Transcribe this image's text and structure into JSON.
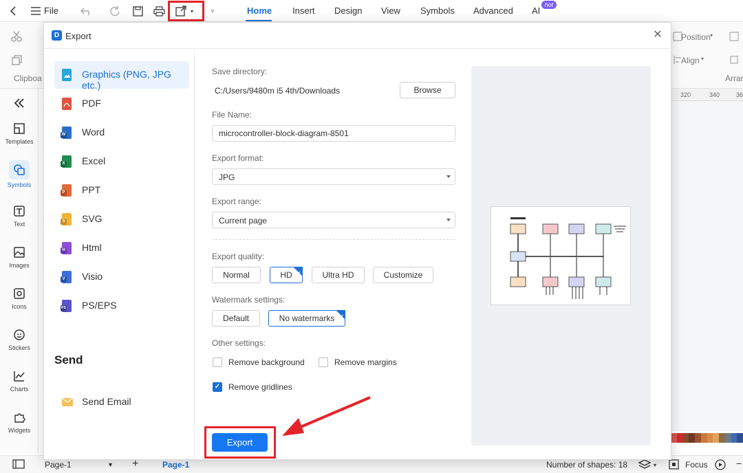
{
  "toolbar": {
    "file_label": "File",
    "tabs": [
      "Home",
      "Insert",
      "Design",
      "View",
      "Symbols",
      "Advanced",
      "AI"
    ],
    "ai_badge": "hot"
  },
  "ribbon": {
    "clipboard_label": "Clipboa",
    "position_label": "Position",
    "align_label": "Align",
    "arrange_label": "Arran",
    "ruler_ticks": [
      "320",
      "340",
      "36"
    ]
  },
  "sidebar": {
    "items": [
      {
        "label": "Templates",
        "icon": "templates-icon"
      },
      {
        "label": "Symbols",
        "icon": "symbols-icon"
      },
      {
        "label": "Text",
        "icon": "text-icon"
      },
      {
        "label": "Images",
        "icon": "images-icon"
      },
      {
        "label": "Icons",
        "icon": "icons-icon"
      },
      {
        "label": "Stickers",
        "icon": "stickers-icon"
      },
      {
        "label": "Charts",
        "icon": "charts-icon"
      },
      {
        "label": "Widgets",
        "icon": "widgets-icon"
      }
    ]
  },
  "dialog": {
    "title": "Export",
    "nav": [
      {
        "label": "Graphics (PNG, JPG etc.)",
        "color": "#2aa6d8",
        "badge": ""
      },
      {
        "label": "PDF",
        "color": "#e0533f",
        "badge": ""
      },
      {
        "label": "Word",
        "color": "#2b6cc4",
        "badge": "W"
      },
      {
        "label": "Excel",
        "color": "#1f8b4c",
        "badge": "X"
      },
      {
        "label": "PPT",
        "color": "#e2693a",
        "badge": "P"
      },
      {
        "label": "SVG",
        "color": "#f0b43a",
        "badge": "S"
      },
      {
        "label": "Html",
        "color": "#8e4fd6",
        "badge": "H"
      },
      {
        "label": "Visio",
        "color": "#3d6fd9",
        "badge": "V"
      },
      {
        "label": "PS/EPS",
        "color": "#5b54c9",
        "badge": "PS"
      }
    ],
    "send_heading": "Send",
    "send_email_label": "Send Email",
    "save_directory_label": "Save directory:",
    "save_directory_value": "C:/Users/9480m i5 4th/Downloads",
    "browse_label": "Browse",
    "file_name_label": "File Name:",
    "file_name_value": "microcontroller-block-diagram-8501",
    "export_format_label": "Export format:",
    "export_format_value": "JPG",
    "export_range_label": "Export range:",
    "export_range_value": "Current page",
    "quality_label": "Export quality:",
    "quality_options": [
      "Normal",
      "HD",
      "Ultra HD",
      "Customize"
    ],
    "quality_selected": "HD",
    "watermark_label": "Watermark settings:",
    "watermark_options": [
      "Default",
      "No watermarks"
    ],
    "watermark_selected": "No watermarks",
    "other_label": "Other settings:",
    "remove_background_label": "Remove background",
    "remove_background_checked": false,
    "remove_margins_label": "Remove margins",
    "remove_margins_checked": false,
    "remove_gridlines_label": "Remove gridlines",
    "remove_gridlines_checked": true,
    "export_button_label": "Export"
  },
  "statusbar": {
    "page_select_value": "Page-1",
    "page_tab": "Page-1",
    "shapes_count": "Number of shapes: 18",
    "focus_label": "Focus"
  },
  "colors": {
    "accent": "#1b6fd6",
    "annotation_red": "#e3242b",
    "palette": [
      "#d9534f",
      "#c9302c",
      "#8b4a2b",
      "#6b3a24",
      "#a0522d",
      "#c67a3c",
      "#d98b4a",
      "#e0a25c",
      "#8b6d4a",
      "#6b7a8f",
      "#3e6db5",
      "#2f4f8f"
    ]
  }
}
